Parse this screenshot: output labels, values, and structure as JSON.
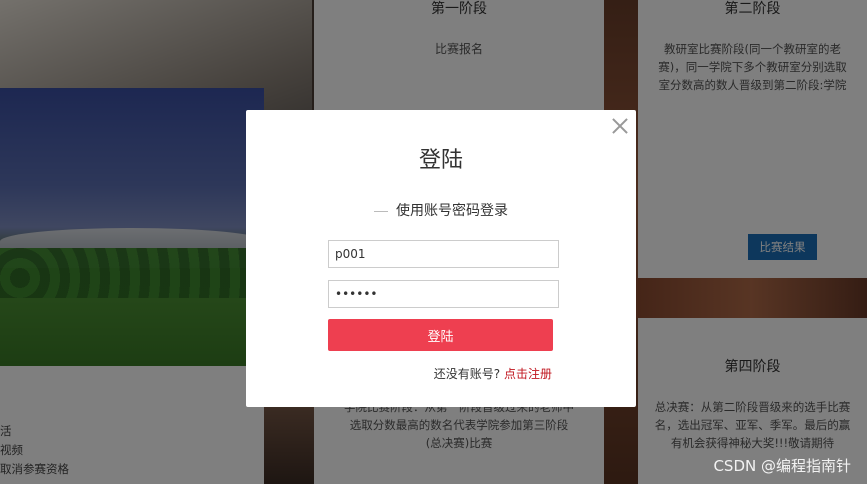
{
  "background": {
    "left_card": {
      "lines": [
        "活",
        "视频",
        "取消参赛资格"
      ]
    },
    "stage1": {
      "title": "第一阶段",
      "subtitle": "比赛报名",
      "desc": "学院比赛阶段：从第一阶段晋级过来的老师中选取分数最高的数名代表学院参加第三阶段(总决赛)比赛"
    },
    "stage2": {
      "title": "第二阶段",
      "desc_lines": [
        "教研室比赛阶段(同一个教研室的老",
        "赛)，同一学院下多个教研室分别选取",
        "室分数高的数人晋级到第二阶段:学院"
      ],
      "button": "比赛结果"
    },
    "stage4": {
      "title": "第四阶段",
      "desc_lines": [
        "总决赛：从第二阶段晋级来的选手比赛",
        "名，选出冠军、亚军、季军。最后的赢",
        "有机会获得神秘大奖!!!敬请期待"
      ]
    }
  },
  "modal": {
    "title": "登陆",
    "subtitle": "使用账号密码登录",
    "username_value": "p001",
    "password_value": "••••••",
    "login_button": "登陆",
    "register_prompt": "还没有账号?",
    "register_link": "点击注册"
  },
  "watermark": "CSDN @编程指南针"
}
